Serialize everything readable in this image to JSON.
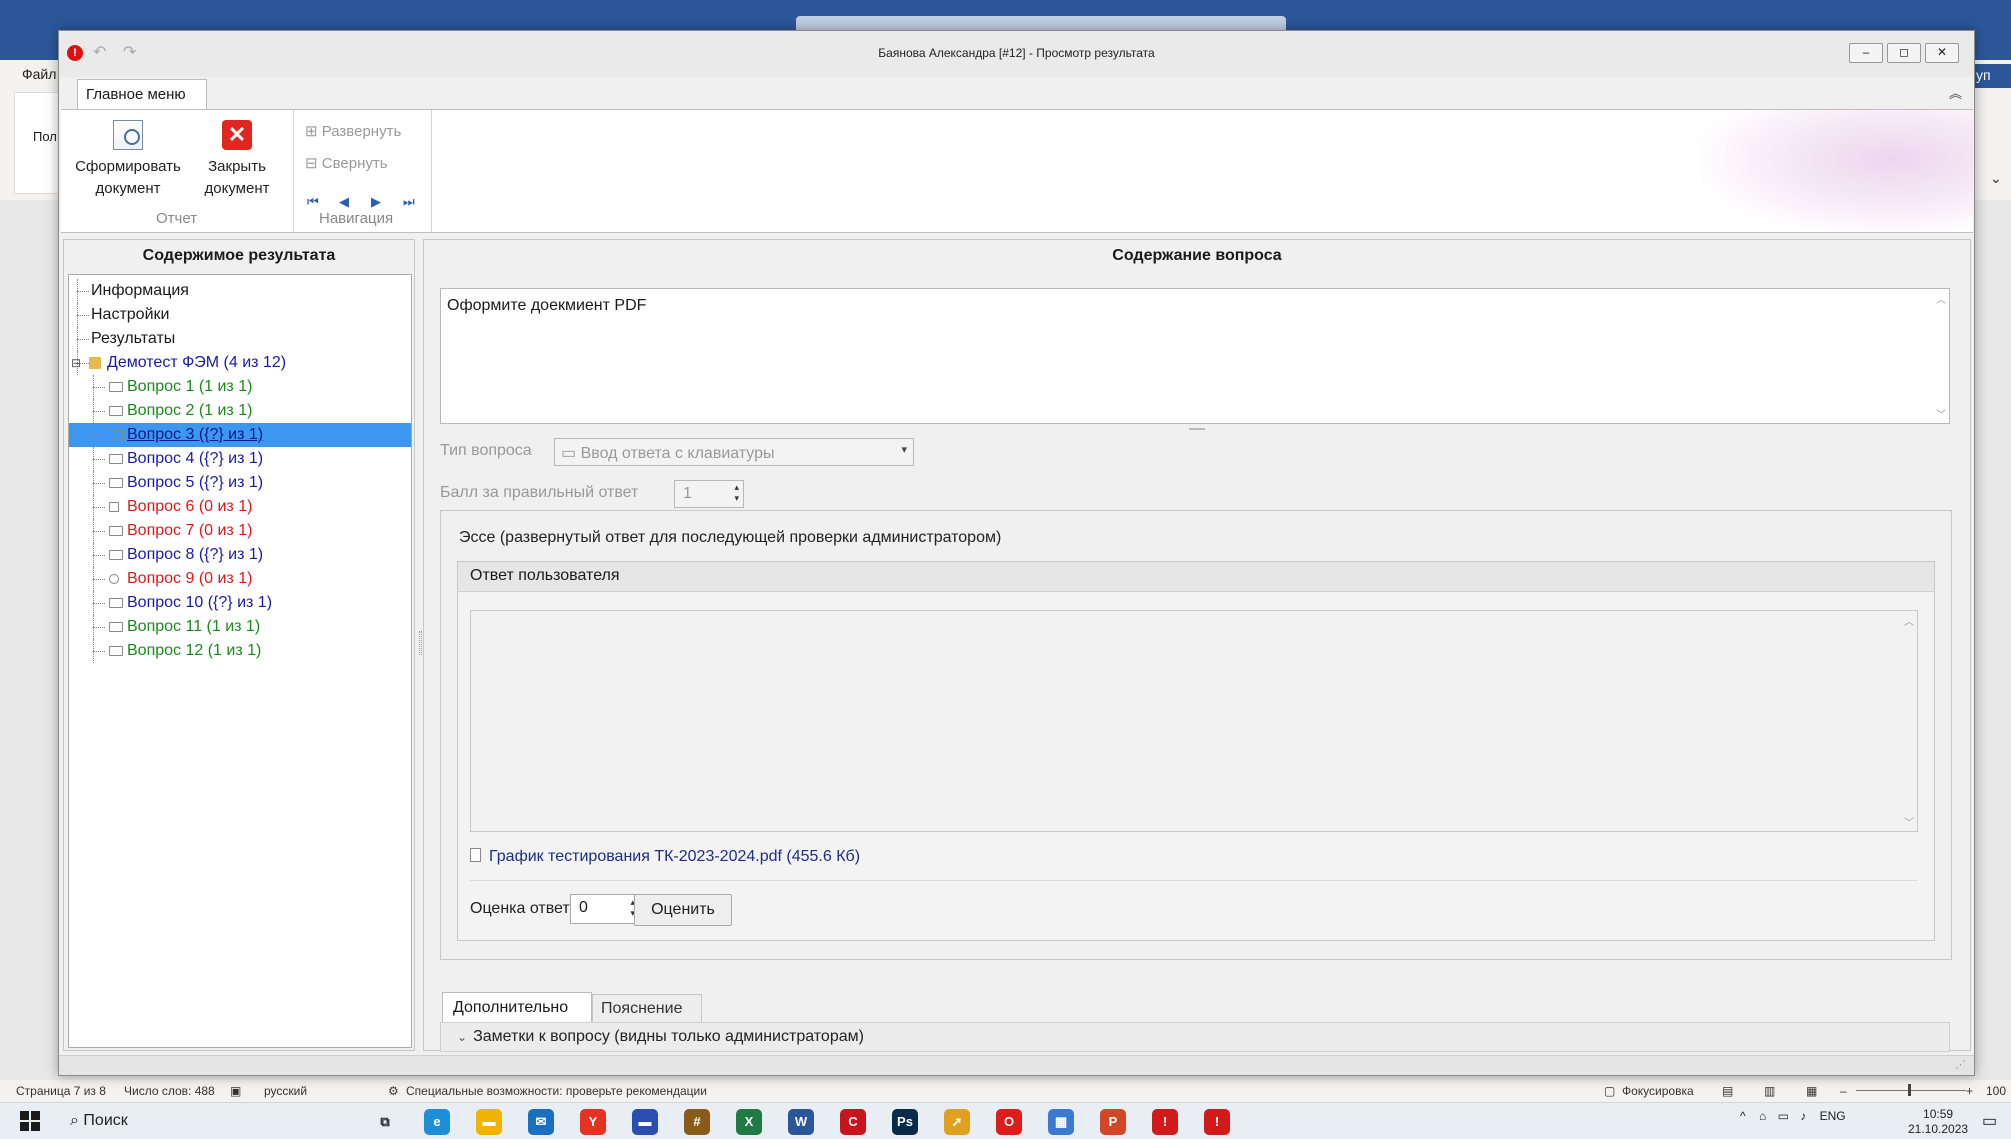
{
  "background": {
    "file_tab": "Файл",
    "ribbon_partial": "Пол",
    "right_tab_partial": "уп",
    "status": {
      "page": "Страница 7 из 8",
      "words": "Число слов: 488",
      "language": "русский",
      "accessibility": "Специальные возможности: проверьте рекомендации",
      "focus": "Фокусировка",
      "zoom": "100"
    }
  },
  "taskbar": {
    "search": "Поиск",
    "tray_lang": "ENG",
    "time": "10:59",
    "date": "21.10.2023",
    "apps": [
      {
        "name": "edge",
        "label": "e",
        "color": "#1e8fd6"
      },
      {
        "name": "explorer",
        "label": "▬",
        "color": "#f0b400"
      },
      {
        "name": "mail",
        "label": "✉",
        "color": "#1b6fc2"
      },
      {
        "name": "yandex",
        "label": "Y",
        "color": "#e63222"
      },
      {
        "name": "flag",
        "label": "▬",
        "color": "#2a4fb0"
      },
      {
        "name": "app-hash",
        "label": "#",
        "color": "#8a5a1a"
      },
      {
        "name": "excel",
        "label": "X",
        "color": "#1f7a43"
      },
      {
        "name": "word",
        "label": "W",
        "color": "#2b579a"
      },
      {
        "name": "app-red",
        "label": "C",
        "color": "#c4161c"
      },
      {
        "name": "photoshop",
        "label": "Ps",
        "color": "#0a2a4a"
      },
      {
        "name": "app-yellow",
        "label": "➚",
        "color": "#e0a020"
      },
      {
        "name": "opera",
        "label": "O",
        "color": "#e01b1b"
      },
      {
        "name": "app-multi",
        "label": "▦",
        "color": "#3a7ad0"
      },
      {
        "name": "powerpoint",
        "label": "P",
        "color": "#d24726"
      },
      {
        "name": "app-info1",
        "label": "!",
        "color": "#d11a1a"
      },
      {
        "name": "app-info2",
        "label": "!",
        "color": "#d11a1a"
      }
    ]
  },
  "window": {
    "title": "Баянова Александра [#12] - Просмотр результата",
    "btn_min": "–",
    "btn_max": "◻",
    "btn_close": "✕"
  },
  "ribbon": {
    "tab": "Главное меню",
    "btn_form_l1": "Сформировать",
    "btn_form_l2": "документ",
    "btn_close_l1": "Закрыть",
    "btn_close_l2": "документ",
    "expand": "Развернуть",
    "collapse": "Свернуть",
    "group_report": "Отчет",
    "group_nav": "Навигация",
    "nav_first": "⏮",
    "nav_prev": "◀",
    "nav_next": "▶",
    "nav_last": "⏭"
  },
  "left": {
    "header": "Содержимое результата",
    "tree": [
      {
        "label": "Информация",
        "color": "black",
        "sel": false
      },
      {
        "label": "Настройки",
        "color": "black",
        "sel": false
      },
      {
        "label": "Результаты",
        "color": "black",
        "sel": false
      },
      {
        "label": "Демотест ФЭМ (4 из 12)",
        "color": "blue",
        "sel": false
      },
      {
        "label": "Вопрос 1 (1 из 1)",
        "color": "green",
        "sel": false
      },
      {
        "label": "Вопрос 2 (1 из 1)",
        "color": "green",
        "sel": false
      },
      {
        "label": "Вопрос 3 ({?} из 1)",
        "color": "blue",
        "sel": true
      },
      {
        "label": "Вопрос 4 ({?} из 1)",
        "color": "blue",
        "sel": false
      },
      {
        "label": "Вопрос 5 ({?} из 1)",
        "color": "blue",
        "sel": false
      },
      {
        "label": "Вопрос 6 (0 из 1)",
        "color": "red",
        "sel": false
      },
      {
        "label": "Вопрос 7 (0 из 1)",
        "color": "red",
        "sel": false
      },
      {
        "label": "Вопрос 8 ({?} из 1)",
        "color": "blue",
        "sel": false
      },
      {
        "label": "Вопрос 9 (0 из 1)",
        "color": "red",
        "sel": false
      },
      {
        "label": "Вопрос 10 ({?} из 1)",
        "color": "blue",
        "sel": false
      },
      {
        "label": "Вопрос 11 (1 из 1)",
        "color": "green",
        "sel": false
      },
      {
        "label": "Вопрос 12 (1 из 1)",
        "color": "green",
        "sel": false
      }
    ]
  },
  "right": {
    "header": "Содержание вопроса",
    "question": "Оформите доекмиент PDF",
    "type_label": "Тип вопроса",
    "type_value": "Ввод ответа с клавиатуры",
    "score_label": "Балл за правильный ответ",
    "score_value": "1",
    "essay_title": "Эссе (развернутый ответ для последующей проверки администратором)",
    "answer_header": "Ответ пользователя",
    "file": "График тестирования ТК-2023-2024.pdf (455.6 Кб)",
    "grade_label": "Оценка ответа",
    "grade_value": "0",
    "grade_button": "Оценить",
    "tab_extra": "Дополнительно",
    "tab_expl": "Пояснение",
    "notes": "Заметки к вопросу (видны только администраторам)"
  }
}
